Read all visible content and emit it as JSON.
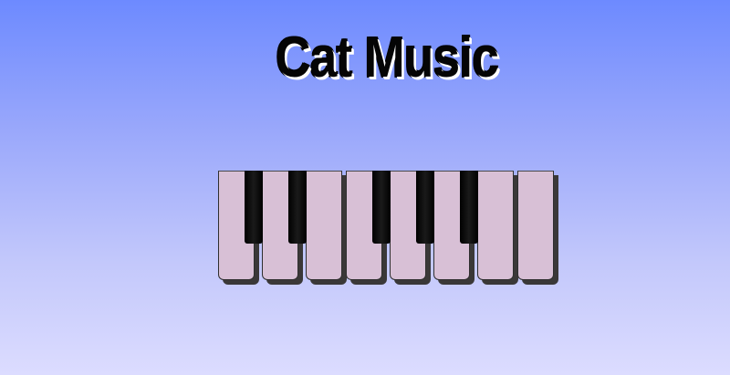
{
  "title": "Cat Music",
  "piano": {
    "white_keys": [
      "white-key-1",
      "white-key-2",
      "white-key-3",
      "white-key-4",
      "white-key-5",
      "white-key-6",
      "white-key-7",
      "white-key-8"
    ],
    "black_keys": [
      "black-key-1",
      "black-key-2",
      "black-key-3",
      "black-key-4",
      "black-key-5"
    ],
    "colors": {
      "white_key": "#d8c0d6",
      "black_key": "#000000",
      "key_shadow": "#3a3838"
    }
  }
}
